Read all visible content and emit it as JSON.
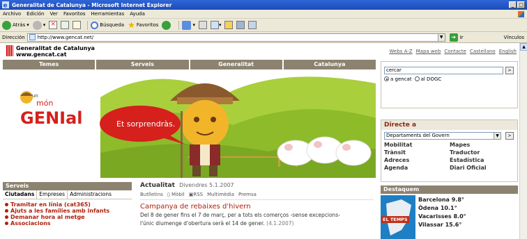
{
  "window": {
    "title": "Generalitat de Catalunya - Microsoft Internet Explorer"
  },
  "menu": [
    "Archivo",
    "Edición",
    "Ver",
    "Favoritos",
    "Herramientas",
    "Ayuda"
  ],
  "toolbar": {
    "back": "Atrás",
    "search": "Búsqueda",
    "favorites": "Favoritos"
  },
  "address": {
    "label": "Dirección",
    "url": "http://www.gencat.net/",
    "go": "Ir",
    "links": "Vínculos"
  },
  "site": {
    "logo_line1": "Generalitat de Catalunya",
    "logo_line2": "www.gencat.cat",
    "top_links": [
      "Webs A-Z",
      "Mapa web",
      "Contacte",
      "Castellano",
      "English"
    ],
    "nav": [
      "Temes",
      "Serveis",
      "Generalitat",
      "Catalunya"
    ],
    "banner": {
      "brand_top": "un",
      "brand_mid": "món",
      "brand_main": "GENIal",
      "speech": "Et sorprendràs."
    },
    "search": {
      "value": "cercar",
      "options": [
        "a gencat",
        "al DOGC"
      ],
      "selected": 0
    },
    "directe": {
      "title": "Directe a",
      "select_value": "Departaments del Govern",
      "links": [
        "Mobilitat",
        "Mapes",
        "Trànsit",
        "Traductor",
        "Adreces",
        "Estadística",
        "Agenda",
        "Diari Oficial"
      ]
    },
    "destacats": {
      "title": "Destaquem",
      "weather_label": "EL TEMPS",
      "temps": [
        "Barcelona 9.8°",
        "Òdena 10.1°",
        "Vacarisses 8.0°",
        "Vilassar 15.6°"
      ]
    },
    "serveis": {
      "title": "Serveis",
      "tabs": [
        "Ciutadans",
        "Empreses",
        "Administracions"
      ],
      "items": [
        "Tramitar en línia (cat365)",
        "Ajuts a les famílies amb infants",
        "Demanar hora al metge",
        "Associacions"
      ]
    },
    "actualitat": {
      "title": "Actualitat",
      "date": "Divendres 5.1.2007",
      "subnav": [
        "Butlletins",
        "Mòbil",
        "RSS",
        "Multimèdia",
        "Premsa"
      ],
      "news_title": "Campanya de rebaixes d'hivern",
      "news_body": "Del 8 de gener fins el 7 de març, per a tots els comerços -sense excepcions-",
      "news_body2": "l'únic diumenge d'obertura serà el 14 de gener.",
      "news_date": "(4.1.2007)"
    }
  }
}
